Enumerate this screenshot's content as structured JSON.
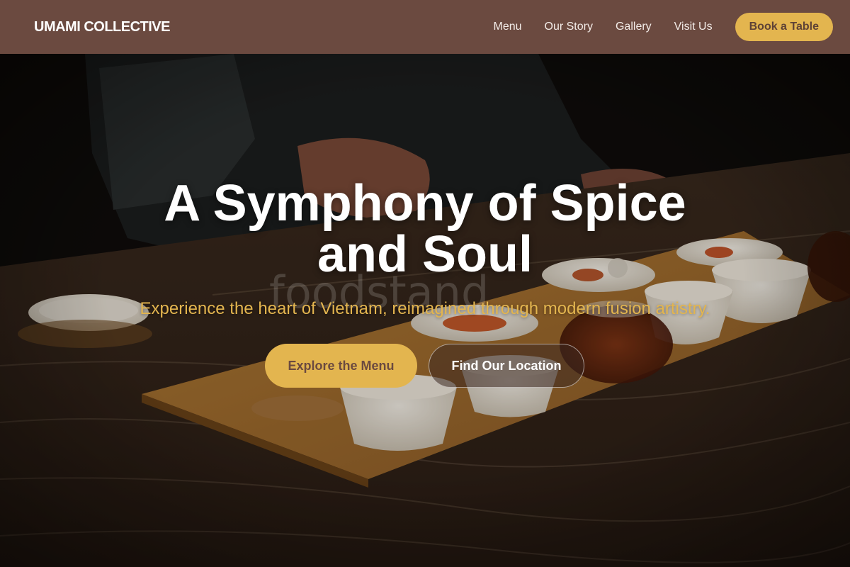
{
  "header": {
    "brand": "UMAMI COLLECTIVE",
    "nav": [
      "Menu",
      "Our Story",
      "Gallery",
      "Visit Us"
    ],
    "cta": "Book a Table"
  },
  "hero": {
    "title_line1": "A Symphony of Spice",
    "title_line2": "and Soul",
    "subtitle": "Experience the heart of Vietnam, reimagined through modern fusion artistry.",
    "watermark": "foodstand",
    "primary_button": "Explore the Menu",
    "secondary_button": "Find Our Location"
  },
  "colors": {
    "header_bg": "#6b4a40",
    "accent_gold": "#e3b54f",
    "text_white": "#ffffff"
  }
}
